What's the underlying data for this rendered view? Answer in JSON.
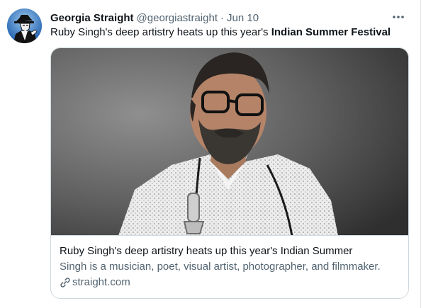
{
  "tweet": {
    "author_name": "Georgia Straight",
    "author_handle": "@georgiastraight",
    "separator": "·",
    "date": "Jun 10",
    "text_plain": "Ruby Singh's deep artistry heats up this year's ",
    "text_bold": "Indian Summer Festival"
  },
  "card": {
    "title": "Ruby Singh's deep artistry heats up this year's Indian Summer",
    "description": "Singh is a musician, poet, visual artist, photographer, and filmmaker.",
    "domain": "straight.com"
  },
  "icons": {
    "more": "more-horizontal-icon",
    "link": "link-icon"
  },
  "colors": {
    "text_primary": "#0f1419",
    "text_secondary": "#536471",
    "border": "#cfd9de"
  }
}
